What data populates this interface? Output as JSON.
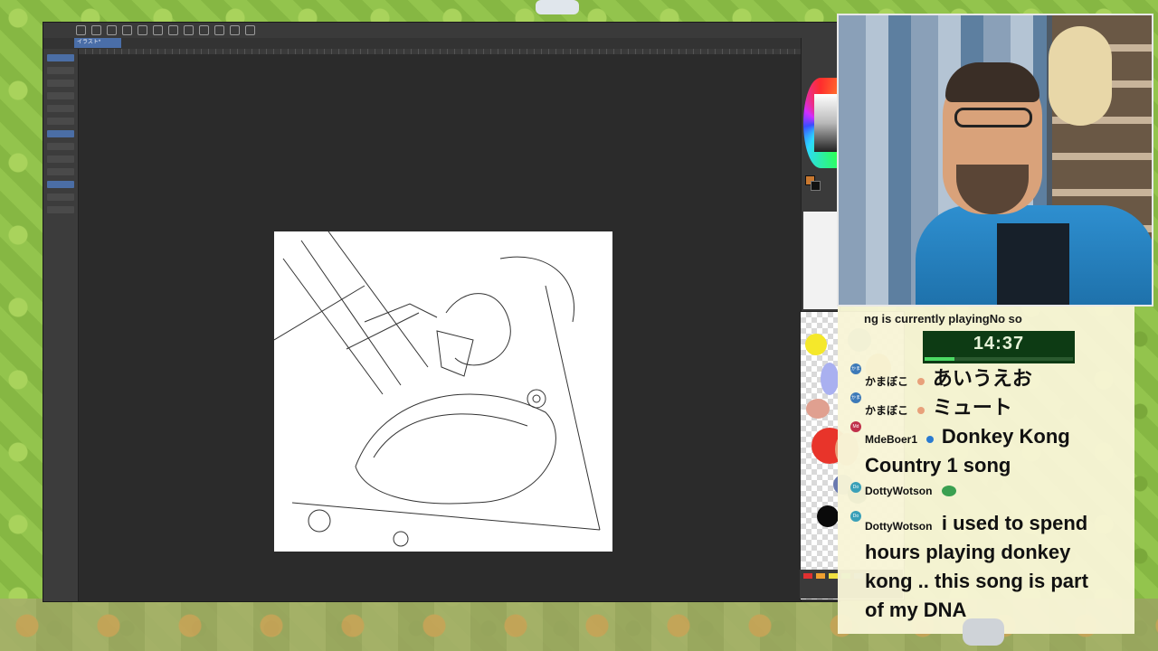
{
  "app": {
    "tab_label": "イラスト*"
  },
  "stream": {
    "now_playing": "ng is currently playingNo so",
    "timer": "14:37",
    "timer_progress": 0.2
  },
  "chat": [
    {
      "user": "かまぼこ",
      "message": "あいうえお"
    },
    {
      "user": "かまぼこ",
      "message": "ミュート"
    },
    {
      "user": "MdeBoer1",
      "message": "Donkey Kong"
    },
    {
      "user": "",
      "message": "Country 1 song"
    },
    {
      "user": "DottyWotson",
      "message": ""
    },
    {
      "user": "DottyWotson",
      "message": "i used to spend"
    },
    {
      "user": "",
      "message": "hours playing donkey"
    },
    {
      "user": "",
      "message": "kong .. this song is part"
    },
    {
      "user": "",
      "message": "of my DNA"
    }
  ],
  "colors": {
    "accent": "#4b6ea5",
    "timer_bg": "#0d3b14",
    "timer_fill": "#4cd964",
    "chat_bg": "#f8f5d6"
  },
  "icons": [
    "search-icon",
    "brush-icon",
    "undo-icon",
    "palette-icon"
  ]
}
